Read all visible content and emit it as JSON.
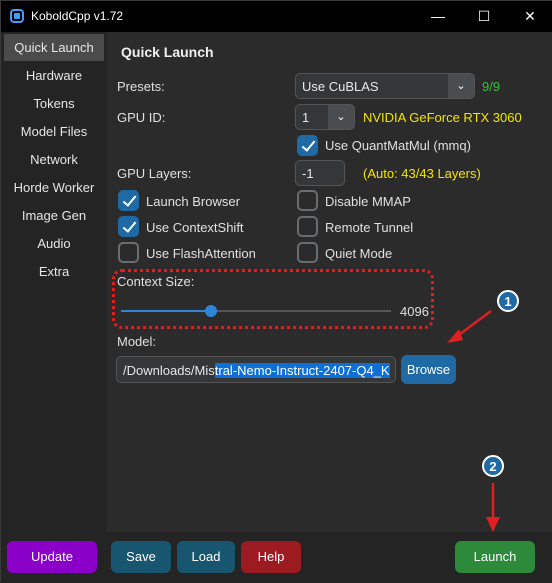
{
  "window": {
    "title": "KoboldCpp v1.72",
    "minimize": "—",
    "maximize": "☐",
    "close": "✕"
  },
  "sidebar": {
    "items": [
      {
        "label": "Quick Launch"
      },
      {
        "label": "Hardware"
      },
      {
        "label": "Tokens"
      },
      {
        "label": "Model Files"
      },
      {
        "label": "Network"
      },
      {
        "label": "Horde Worker"
      },
      {
        "label": "Image Gen"
      },
      {
        "label": "Audio"
      },
      {
        "label": "Extra"
      }
    ]
  },
  "main": {
    "heading": "Quick Launch",
    "presets": {
      "label": "Presets:",
      "value": "Use CuBLAS",
      "count": "9/9"
    },
    "gpu_id": {
      "label": "GPU ID:",
      "value": "1",
      "device": "NVIDIA GeForce RTX 3060"
    },
    "quantmatmul": {
      "label": "Use QuantMatMul (mmq)",
      "checked": true
    },
    "gpu_layers": {
      "label": "GPU Layers:",
      "value": "-1",
      "auto": "(Auto: 43/43 Layers)"
    },
    "checkboxes": {
      "launch_browser": {
        "label": "Launch Browser",
        "checked": true
      },
      "disable_mmap": {
        "label": "Disable MMAP",
        "checked": false
      },
      "context_shift": {
        "label": "Use ContextShift",
        "checked": true
      },
      "remote_tunnel": {
        "label": "Remote Tunnel",
        "checked": false
      },
      "flash_attention": {
        "label": "Use FlashAttention",
        "checked": false
      },
      "quiet_mode": {
        "label": "Quiet Mode",
        "checked": false
      }
    },
    "context_size": {
      "label": "Context Size:",
      "value": "4096"
    },
    "model": {
      "label": "Model:",
      "value_plain": "/Downloads/Mis",
      "value_selected": "tral-Nemo-Instruct-2407-Q4_K",
      "browse": "Browse"
    }
  },
  "bottom": {
    "update": "Update",
    "save": "Save",
    "load": "Load",
    "help": "Help",
    "launch": "Launch"
  },
  "annotations": {
    "badge1": "1",
    "badge2": "2"
  },
  "colors": {
    "accent": "#1f6aa5",
    "update": "#8a00c8",
    "save": "#17566e",
    "help": "#9b1b20",
    "launch": "#2c8a3a",
    "annotation": "#e02020"
  }
}
